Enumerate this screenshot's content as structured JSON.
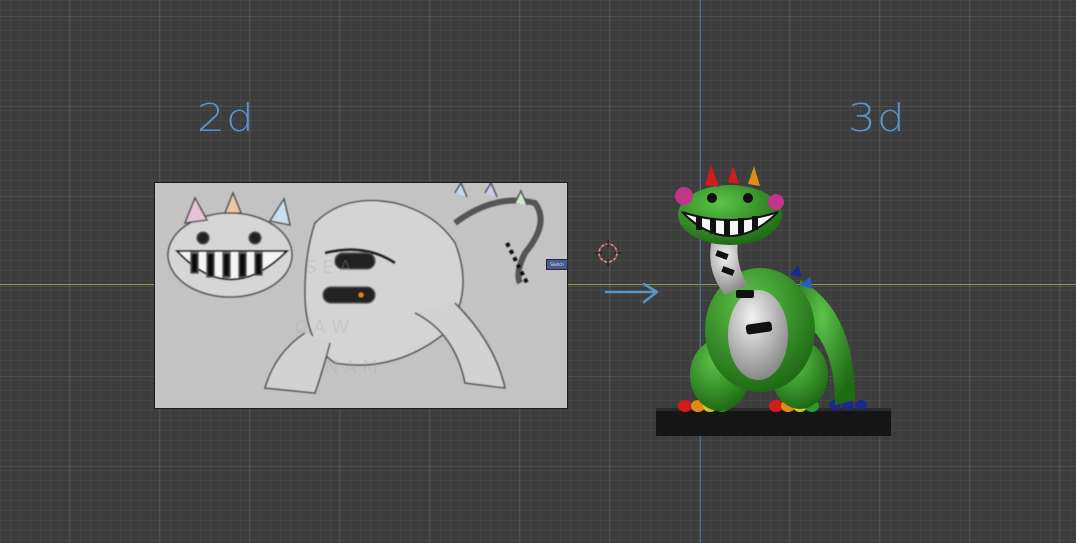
{
  "viewport": {
    "labels": {
      "left": "2d",
      "right": "3d"
    },
    "reference_image": {
      "tag": "Sketch"
    },
    "colors": {
      "background": "#3d3d3d",
      "x_axis": "#8fa032",
      "y_axis": "#3d6fa8",
      "annotation": "#5b93c9",
      "model_body": "#2f8f1f",
      "pedestal": "#151515"
    },
    "icons": [
      "3d-cursor-icon",
      "right-arrow-annotation"
    ]
  }
}
